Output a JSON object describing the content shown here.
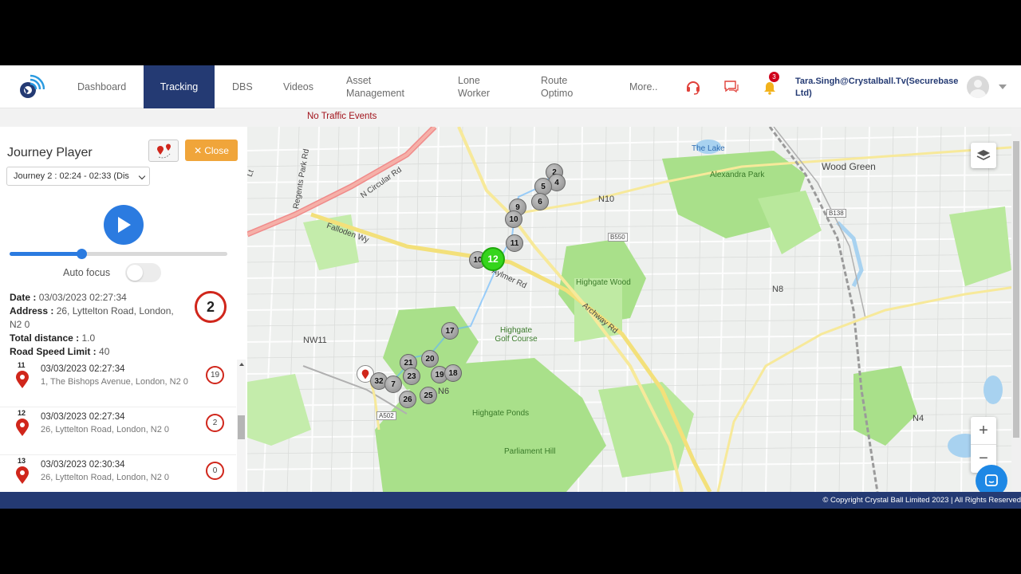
{
  "nav": {
    "items": [
      {
        "label": "Dashboard"
      },
      {
        "label": "Tracking"
      },
      {
        "label": "DBS"
      },
      {
        "label": "Videos"
      },
      {
        "label": "Asset Management"
      },
      {
        "label": "Lone Worker"
      },
      {
        "label": "Route Optimo"
      },
      {
        "label": "More.."
      }
    ],
    "active": "Tracking",
    "notification_count": "3",
    "user": "Tara.Singh@Crystalball.Tv(Securebase Ltd)",
    "icons": [
      "headset-icon",
      "chat-icon",
      "bell-icon"
    ]
  },
  "subbar": {
    "traffic": "No Traffic Events"
  },
  "panel": {
    "title": "Journey Player",
    "close_label": "Close",
    "journey_select": "Journey 2 : 02:24 - 02:33 (Dis",
    "progress_percent": 33,
    "autofocus_label": "Auto focus",
    "autofocus_on": false,
    "details": {
      "date_label": "Date :",
      "date_value": "03/03/2023 02:27:34",
      "address_label": "Address :",
      "address_value": "26, Lyttelton Road, London, N2 0",
      "distance_label": "Total distance :",
      "distance_value": "1.0",
      "speed_label": "Road Speed Limit :",
      "speed_value": "40",
      "count": "2"
    },
    "events": [
      {
        "index": "11",
        "date": "03/03/2023 02:27:34",
        "address": "1, The Bishops Avenue, London, N2 0",
        "count": "19"
      },
      {
        "index": "12",
        "date": "03/03/2023 02:27:34",
        "address": "26, Lyttelton Road, London, N2 0",
        "count": "2"
      },
      {
        "index": "13",
        "date": "03/03/2023 02:30:34",
        "address": "26, Lyttelton Road, London, N2 0",
        "count": "0"
      }
    ]
  },
  "map": {
    "markers": [
      "2",
      "4",
      "5",
      "6",
      "9",
      "10",
      "11",
      "10",
      "12",
      "17",
      "20",
      "21",
      "23",
      "19",
      "18",
      "32",
      "7",
      "25",
      "26"
    ],
    "labels": {
      "the_lake": "The Lake",
      "alexandra_park": "Alexandra Park",
      "wood_green": "Wood Green",
      "n10": "N10",
      "b550": "B550",
      "b138": "B138",
      "highgate_wood": "Highgate Wood",
      "n8": "N8",
      "highgate_golf": "Highgate Golf Course",
      "nw11": "NW11",
      "n6": "N6",
      "highgate_ponds": "Highgate Ponds",
      "parliament_hill": "Parliament Hill",
      "n4": "N4",
      "a502": "A502",
      "n_circular": "N Circular Rd",
      "regents_park": "Regents Park Rd",
      "falloden": "Falloden Wy",
      "aylmer": "Aylmer Rd",
      "archway": "Archway Rd",
      "lt": "Lt"
    }
  },
  "footer": {
    "copyright": "© Copyright Crystal Ball Limited 2023 | All Rights Reserved"
  },
  "colors": {
    "brand": "#243a73",
    "accent": "#2b7be0",
    "close": "#f0a53a",
    "alert": "#d0261b",
    "current_marker": "#35d51c"
  }
}
